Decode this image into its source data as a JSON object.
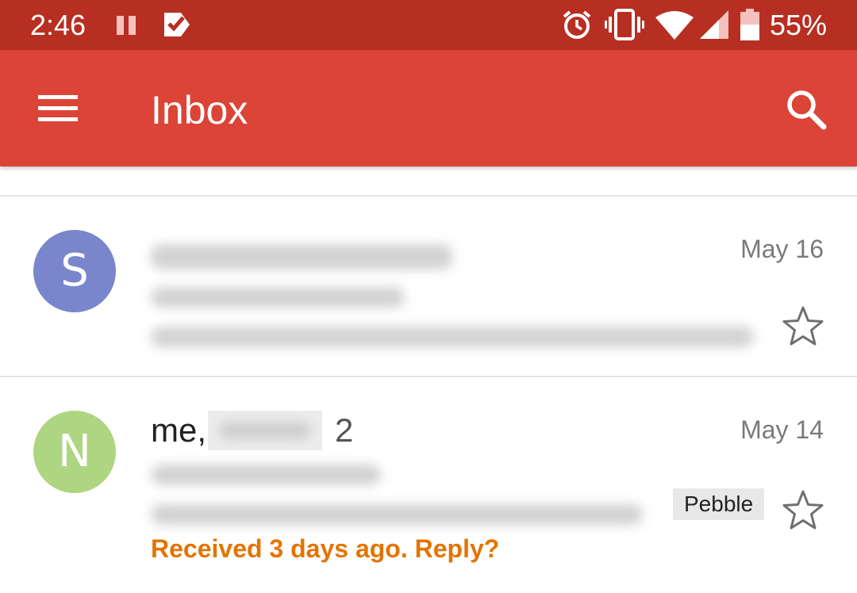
{
  "status_bar": {
    "time": "2:46",
    "battery_percent": "55%",
    "icons": [
      "pause-icon",
      "task-check-icon",
      "alarm-icon",
      "vibrate-icon",
      "wifi-icon",
      "cell-signal-icon",
      "battery-icon"
    ]
  },
  "app_bar": {
    "title": "Inbox",
    "menu_icon": "hamburger-menu-icon",
    "search_icon": "search-icon"
  },
  "colors": {
    "status_bar": "#b72f22",
    "app_bar": "#db4437",
    "avatar_s": "#7986cb",
    "avatar_n": "#aed581",
    "nudge": "#e37400"
  },
  "emails": [
    {
      "avatar_letter": "S",
      "date": "May 16",
      "starred": false
    },
    {
      "avatar_letter": "N",
      "sender_prefix": "me,",
      "thread_count": "2",
      "date": "May 14",
      "label": "Pebble",
      "nudge": "Received 3 days ago. Reply?",
      "starred": false
    }
  ]
}
